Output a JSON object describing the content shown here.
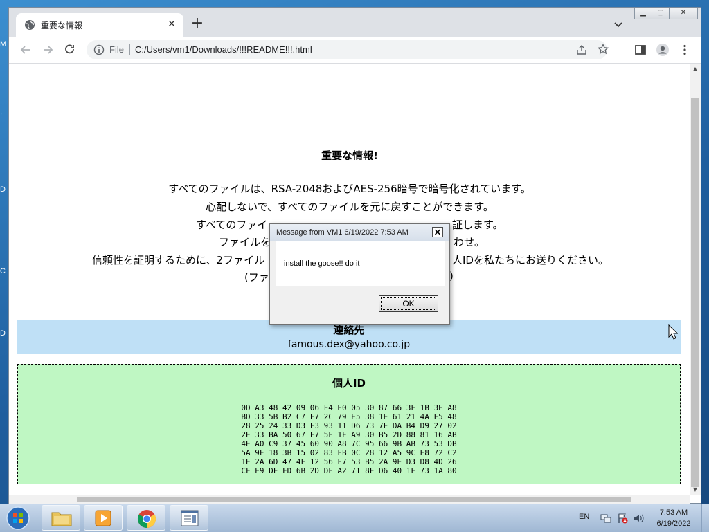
{
  "desktop": {
    "edge_labels": [
      "M",
      "!",
      "D",
      "C",
      "D"
    ]
  },
  "browser": {
    "tab_title": "重要な情報",
    "tab_close": "✕",
    "new_tab": "+",
    "address_scheme": "File",
    "address_url": "C:/Users/vm1/Downloads/!!!README!!!.html"
  },
  "page": {
    "heading": "重要な情報!",
    "lines": [
      "すべてのファイルは、RSA-2048およびAES-256暗号で暗号化されています。",
      "心配しないで、すべてのファイルを元に戻すことができます。",
      "すべてのファイ",
      "ファイルを",
      "信頼性を証明するために、2ファイル",
      "(ファ"
    ],
    "line_tails": [
      "",
      "",
      "証します。",
      "わせ。",
      "人IDを私たちにお送りください。",
      ")"
    ],
    "contact_title": "連絡先",
    "contact_email": "famous.dex@yahoo.co.jp",
    "id_title": "個人ID",
    "id_hex": "0D A3 48 42 09 06 F4 E0 05 30 87 66 3F 1B 3E A8\nBD 33 5B B2 C7 F7 2C 79 E5 38 1E 61 21 4A F5 48\n28 25 24 33 D3 F3 93 11 D6 73 7F DA B4 D9 27 02\n2E 33 BA 50 67 F7 5F 1F A9 30 B5 2D 88 81 16 AB\n4E A0 C9 37 45 60 90 A8 7C 95 66 9B AB 73 53 DB\n5A 9F 18 3B 15 02 83 FB 0C 28 12 A5 9C E8 72 C2\n1E 2A 6D 47 4F 12 56 F7 53 B5 2A 9E D3 D8 4D 26\nCF E9 DF FD 6B 2D DF A2 71 8F D6 40 1F 73 1A 80"
  },
  "dialog": {
    "title": "Message from VM1 6/19/2022 7:53 AM",
    "message": "install the goose!! do it",
    "ok_label": "OK"
  },
  "taskbar": {
    "language": "EN",
    "time": "7:53 AM",
    "date": "6/19/2022"
  }
}
